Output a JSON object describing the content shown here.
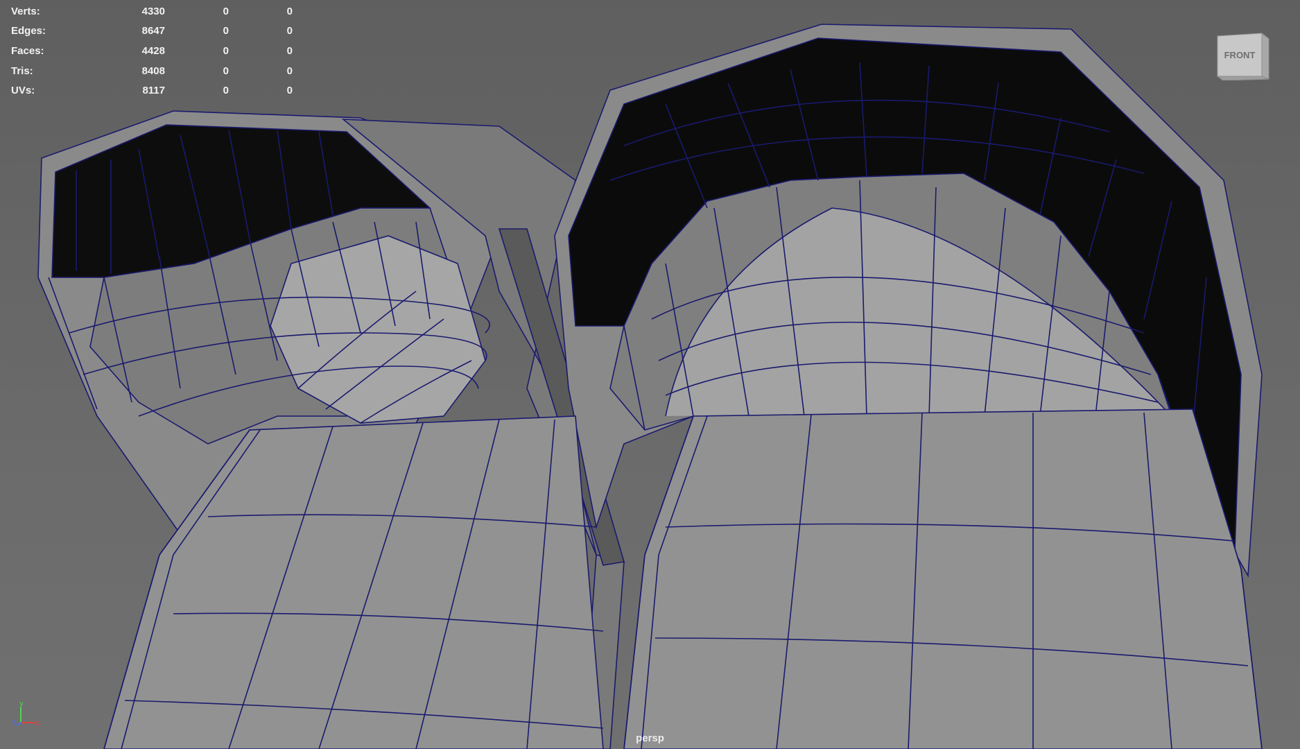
{
  "heads_up": {
    "rows": [
      {
        "label": "Verts:",
        "values": [
          "4330",
          "0",
          "0"
        ]
      },
      {
        "label": "Edges:",
        "values": [
          "8647",
          "0",
          "0"
        ]
      },
      {
        "label": "Faces:",
        "values": [
          "4428",
          "0",
          "0"
        ]
      },
      {
        "label": "Tris:",
        "values": [
          "8408",
          "0",
          "0"
        ]
      },
      {
        "label": "UVs:",
        "values": [
          "8117",
          "0",
          "0"
        ]
      }
    ]
  },
  "viewcube": {
    "face_label": "FRONT"
  },
  "camera": {
    "label": "persp"
  },
  "axis_gizmo": {
    "y": "y",
    "z": "z",
    "x": "x"
  },
  "colors": {
    "viewport_bg": "#6b6b6b",
    "wire": "#1a1a6e",
    "face_light": "#9a9a9a",
    "face_dark": "#0b0b0b",
    "hud_text": "#f2f2f2"
  }
}
